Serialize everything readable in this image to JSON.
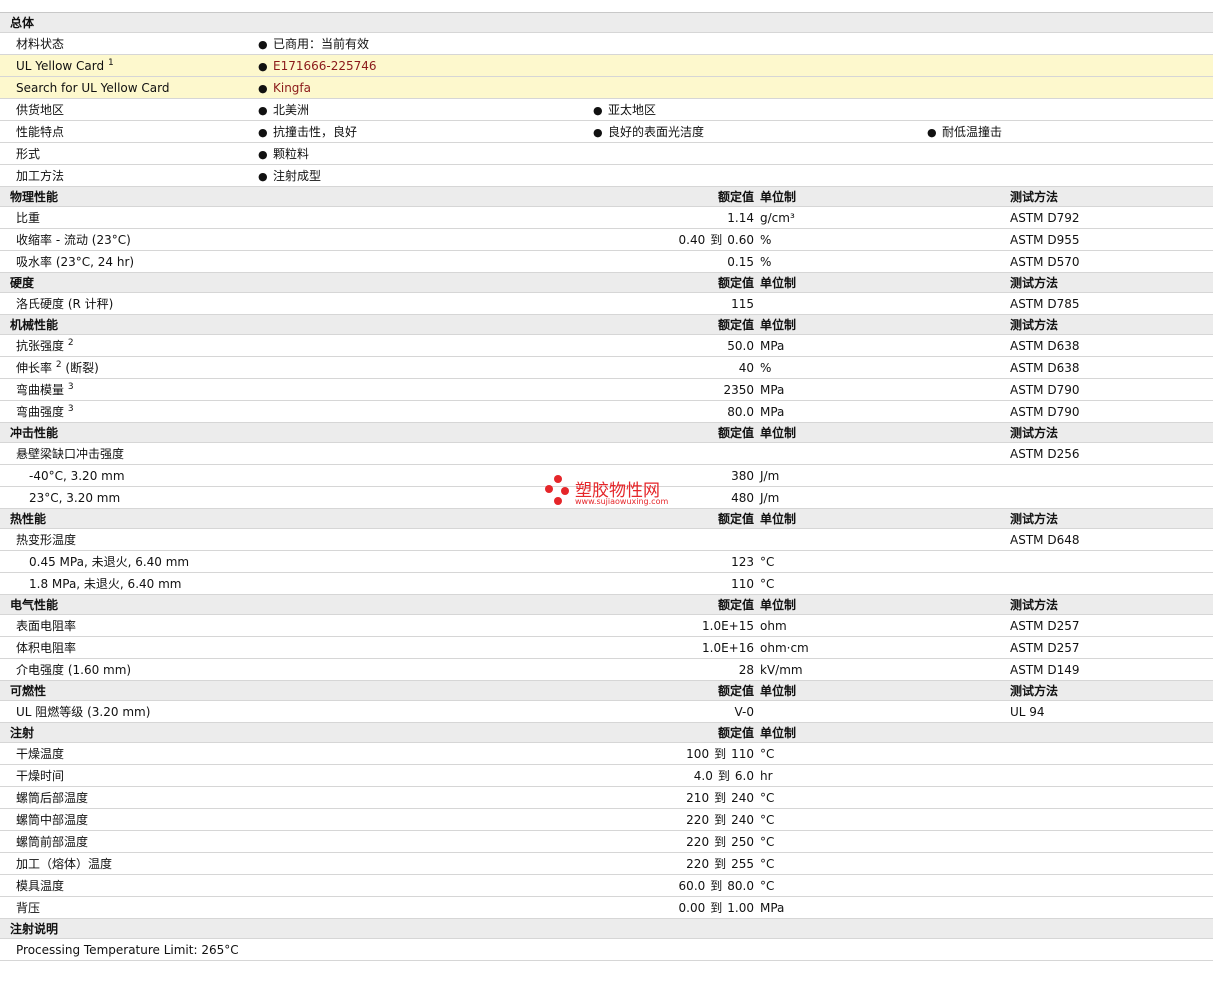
{
  "general": {
    "title": "总体",
    "material_status": {
      "label": "材料状态",
      "value": "已商用：当前有效"
    },
    "ul_card": {
      "label": "UL Yellow Card",
      "sup": "1",
      "value": "E171666-225746"
    },
    "ul_search": {
      "label": "Search for UL Yellow Card",
      "value": "Kingfa"
    },
    "supply": {
      "label": "供货地区",
      "values": [
        "北美洲",
        "亚太地区"
      ]
    },
    "features": {
      "label": "性能特点",
      "values": [
        "抗撞击性，良好",
        "良好的表面光洁度",
        "耐低温撞击"
      ]
    },
    "form": {
      "label": "形式",
      "value": "颗粒料"
    },
    "processing": {
      "label": "加工方法",
      "value": "注射成型"
    }
  },
  "headers": {
    "nominal": "额定值",
    "unit": "单位制",
    "test": "测试方法"
  },
  "range_to": "到",
  "physical": {
    "title": "物理性能",
    "rows": [
      {
        "label": "比重",
        "value": "1.14",
        "unit": "g/cm³",
        "test": "ASTM D792"
      },
      {
        "label": "收缩率 - 流动 (23°C)",
        "value_lo": "0.40",
        "value_hi": "0.60",
        "unit": "%",
        "test": "ASTM D955"
      },
      {
        "label": "吸水率 (23°C, 24 hr)",
        "value": "0.15",
        "unit": "%",
        "test": "ASTM D570"
      }
    ]
  },
  "hardness": {
    "title": "硬度",
    "rows": [
      {
        "label": "洛氏硬度 (R 计秤)",
        "value": "115",
        "unit": "",
        "test": "ASTM D785"
      }
    ]
  },
  "mechanical": {
    "title": "机械性能",
    "rows": [
      {
        "label": "抗张强度",
        "sup": "2",
        "suffix": "",
        "value": "50.0",
        "unit": "MPa",
        "test": "ASTM D638"
      },
      {
        "label": "伸长率",
        "sup": "2",
        "suffix": " (断裂)",
        "value": "40",
        "unit": "%",
        "test": "ASTM D638"
      },
      {
        "label": "弯曲模量",
        "sup": "3",
        "suffix": "",
        "value": "2350",
        "unit": "MPa",
        "test": "ASTM D790"
      },
      {
        "label": "弯曲强度",
        "sup": "3",
        "suffix": "",
        "value": "80.0",
        "unit": "MPa",
        "test": "ASTM D790"
      }
    ]
  },
  "impact": {
    "title": "冲击性能",
    "main": {
      "label": "悬壁梁缺口冲击强度",
      "test": "ASTM D256"
    },
    "rows": [
      {
        "label": "-40°C, 3.20 mm",
        "value": "380",
        "unit": "J/m"
      },
      {
        "label": "23°C, 3.20 mm",
        "value": "480",
        "unit": "J/m"
      }
    ]
  },
  "thermal": {
    "title": "热性能",
    "main": {
      "label": "热变形温度",
      "test": "ASTM D648"
    },
    "rows": [
      {
        "label": "0.45 MPa, 未退火, 6.40 mm",
        "value": "123",
        "unit": "°C"
      },
      {
        "label": "1.8 MPa, 未退火, 6.40 mm",
        "value": "110",
        "unit": "°C"
      }
    ]
  },
  "electrical": {
    "title": "电气性能",
    "rows": [
      {
        "label": "表面电阻率",
        "value": "1.0E+15",
        "unit": "ohm",
        "test": "ASTM D257"
      },
      {
        "label": "体积电阻率",
        "value": "1.0E+16",
        "unit": "ohm·cm",
        "test": "ASTM D257"
      },
      {
        "label": "介电强度 (1.60 mm)",
        "value": "28",
        "unit": "kV/mm",
        "test": "ASTM D149"
      }
    ]
  },
  "flammability": {
    "title": "可燃性",
    "rows": [
      {
        "label": "UL 阻燃等级 (3.20 mm)",
        "value": "V-0",
        "unit": "",
        "test": "UL 94"
      }
    ]
  },
  "injection": {
    "title": "注射",
    "rows": [
      {
        "label": "干燥温度",
        "lo": "100",
        "hi": "110",
        "unit": "°C"
      },
      {
        "label": "干燥时间",
        "lo": "4.0",
        "hi": "6.0",
        "unit": "hr"
      },
      {
        "label": "螺筒后部温度",
        "lo": "210",
        "hi": "240",
        "unit": "°C"
      },
      {
        "label": "螺筒中部温度",
        "lo": "220",
        "hi": "240",
        "unit": "°C"
      },
      {
        "label": "螺筒前部温度",
        "lo": "220",
        "hi": "250",
        "unit": "°C"
      },
      {
        "label": "加工（熔体）温度",
        "lo": "220",
        "hi": "255",
        "unit": "°C"
      },
      {
        "label": "模具温度",
        "lo": "60.0",
        "hi": "80.0",
        "unit": "°C"
      },
      {
        "label": "背压",
        "lo": "0.00",
        "hi": "1.00",
        "unit": "MPa"
      }
    ]
  },
  "injection_notes": {
    "title": "注射说明",
    "text": "Processing Temperature Limit: 265°C"
  },
  "watermark": {
    "name": "塑胶物性网",
    "url": "www.sujiaowuxing.com"
  },
  "colors": {
    "section_bg": "#ececec",
    "highlight_bg": "#fdf8cd",
    "link": "#8b1a1a",
    "watermark": "#e5262a"
  }
}
